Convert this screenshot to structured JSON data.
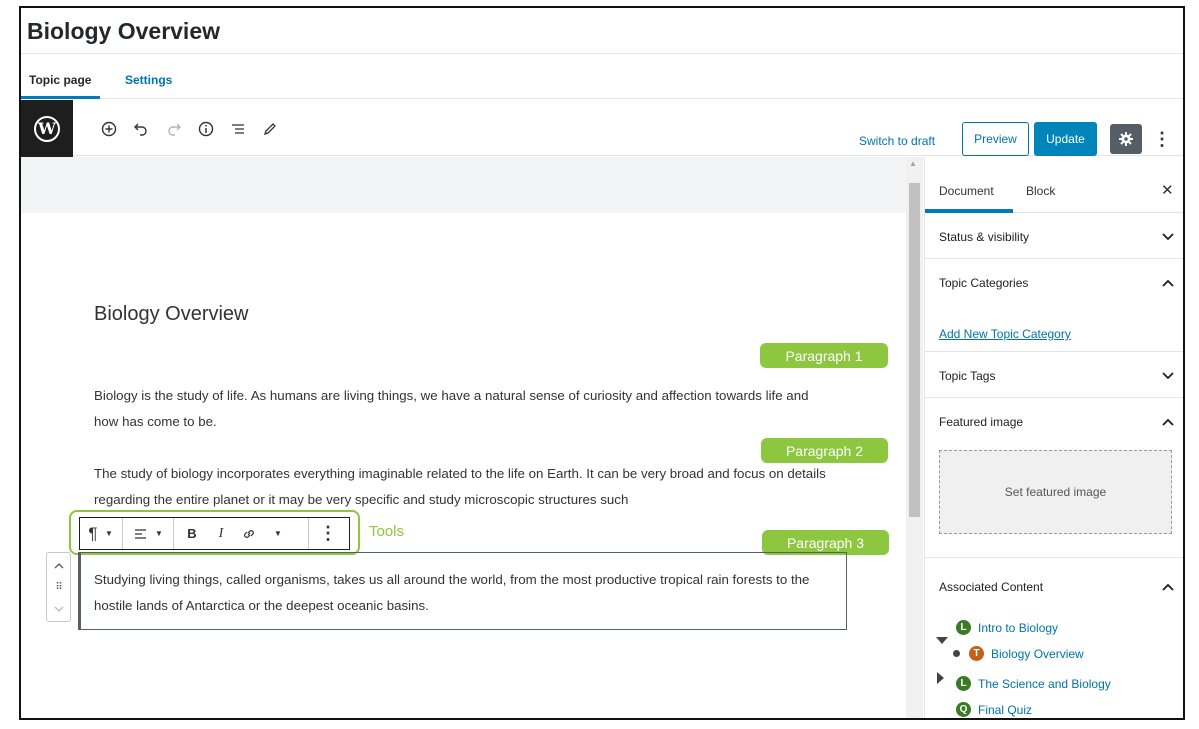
{
  "page": {
    "title": "Biology Overview"
  },
  "tabs": {
    "active": "Topic page",
    "other": "Settings"
  },
  "header": {
    "switch_draft": "Switch to draft",
    "preview": "Preview",
    "update": "Update",
    "icons": [
      "wordpress-logo",
      "add-block-icon",
      "undo-icon",
      "redo-icon",
      "info-icon",
      "outline-icon",
      "edit-icon",
      "gear-icon",
      "more-vertical-icon"
    ]
  },
  "editor": {
    "post_title": "Biology Overview",
    "paragraphs": [
      "Biology is the study of life. As humans are living things, we have a natural sense of curiosity and affection towards life and how has come to be.",
      "The study of biology incorporates everything imaginable related to the life on Earth. It can be very broad and focus on details regarding the entire planet or it may be very specific and study microscopic structures such",
      "Studying living things, called organisms, takes us all around the world, from the most productive tropical rain forests to the hostile lands of Antarctica or the deepest oceanic basins."
    ],
    "annotations": {
      "p1": "Paragraph 1",
      "p2": "Paragraph 2",
      "p3": "Paragraph 3",
      "tools": "Tools"
    },
    "toolbar": {
      "paragraph_glyph": "¶",
      "bold_glyph": "B",
      "italic_glyph": "I"
    }
  },
  "sidebar": {
    "tab_document": "Document",
    "tab_block": "Block",
    "panels": {
      "status": "Status & visibility",
      "categories": "Topic Categories",
      "add_category": "Add New Topic Category",
      "tags": "Topic Tags",
      "featured": "Featured image",
      "set_featured": "Set featured image",
      "associated": "Associated Content"
    },
    "associated": [
      {
        "badge": "L",
        "label": "Intro to Biology"
      },
      {
        "badge": "T",
        "label": "Biology Overview"
      },
      {
        "badge": "L",
        "label": "The Science and Biology"
      },
      {
        "badge": "Q",
        "label": "Final Quiz"
      }
    ]
  },
  "colors": {
    "accent": "#007cba",
    "update": "#0085ba",
    "annotation": "#8dc63f",
    "link": "#0073aa"
  }
}
